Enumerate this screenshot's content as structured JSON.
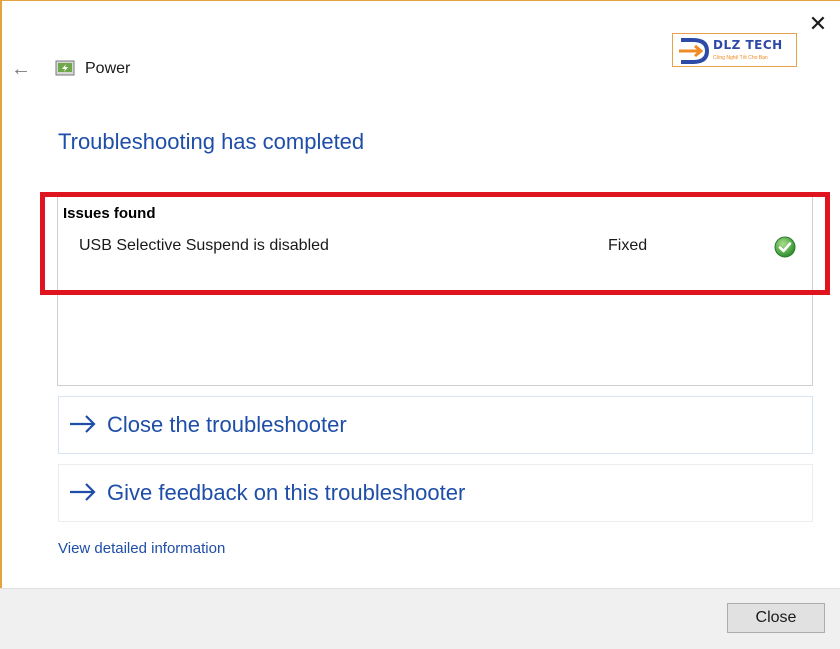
{
  "window": {
    "title": "Power",
    "close_glyph": "✕",
    "back_glyph": "←"
  },
  "logo": {
    "name": "DLZ TECH",
    "tagline": "Công Nghệ Tốt Cho Bạn",
    "colors": {
      "brand_blue": "#2d4aa8",
      "brand_orange": "#f08a24"
    }
  },
  "main": {
    "heading": "Troubleshooting has completed",
    "issues": {
      "heading": "Issues found",
      "rows": [
        {
          "name": "USB Selective Suspend is disabled",
          "status": "Fixed",
          "icon": "check-icon"
        }
      ]
    },
    "actions": [
      {
        "label": "Close the troubleshooter",
        "icon": "arrow-right-icon"
      },
      {
        "label": "Give feedback on this troubleshooter",
        "icon": "arrow-right-icon"
      }
    ],
    "details_link": "View detailed information"
  },
  "footer": {
    "close_label": "Close"
  },
  "colors": {
    "link_blue": "#1f4ea8",
    "highlight_red": "#e0141e",
    "success_green": "#3aa53a"
  }
}
